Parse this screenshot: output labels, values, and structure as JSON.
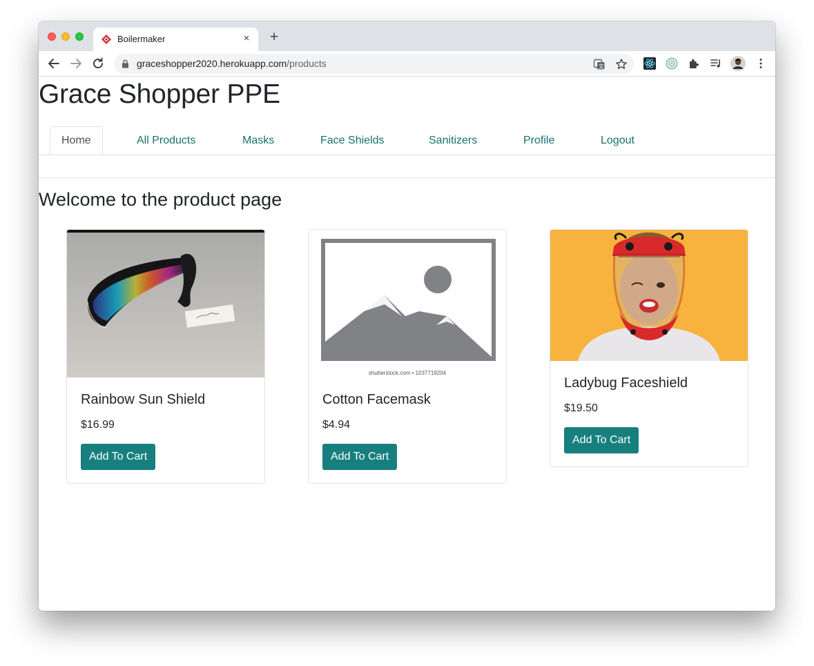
{
  "browser": {
    "tab_title": "Boilermaker",
    "tab_close": "×",
    "new_tab": "+",
    "url_host": "graceshopper2020.herokuapp.com",
    "url_path": "/products"
  },
  "site": {
    "title": "Grace Shopper PPE",
    "nav": [
      "Home",
      "All Products",
      "Masks",
      "Face Shields",
      "Sanitizers",
      "Profile",
      "Logout"
    ],
    "active_nav": "Home",
    "heading": "Welcome to the product page"
  },
  "products": [
    {
      "name": "Rainbow Sun Shield",
      "price": "$16.99",
      "button": "Add To Cart",
      "image": "rainbow-visor-photo"
    },
    {
      "name": "Cotton Facemask",
      "price": "$4.94",
      "button": "Add To Cart",
      "image": "placeholder-image",
      "image_caption": "shutterstock.com • 1037719204"
    },
    {
      "name": "Ladybug Faceshield",
      "price": "$19.50",
      "button": "Add To Cart",
      "image": "ladybug-faceshield-photo"
    }
  ],
  "colors": {
    "accent": "#17807e",
    "nav_link": "#17706e",
    "text": "#212529"
  }
}
